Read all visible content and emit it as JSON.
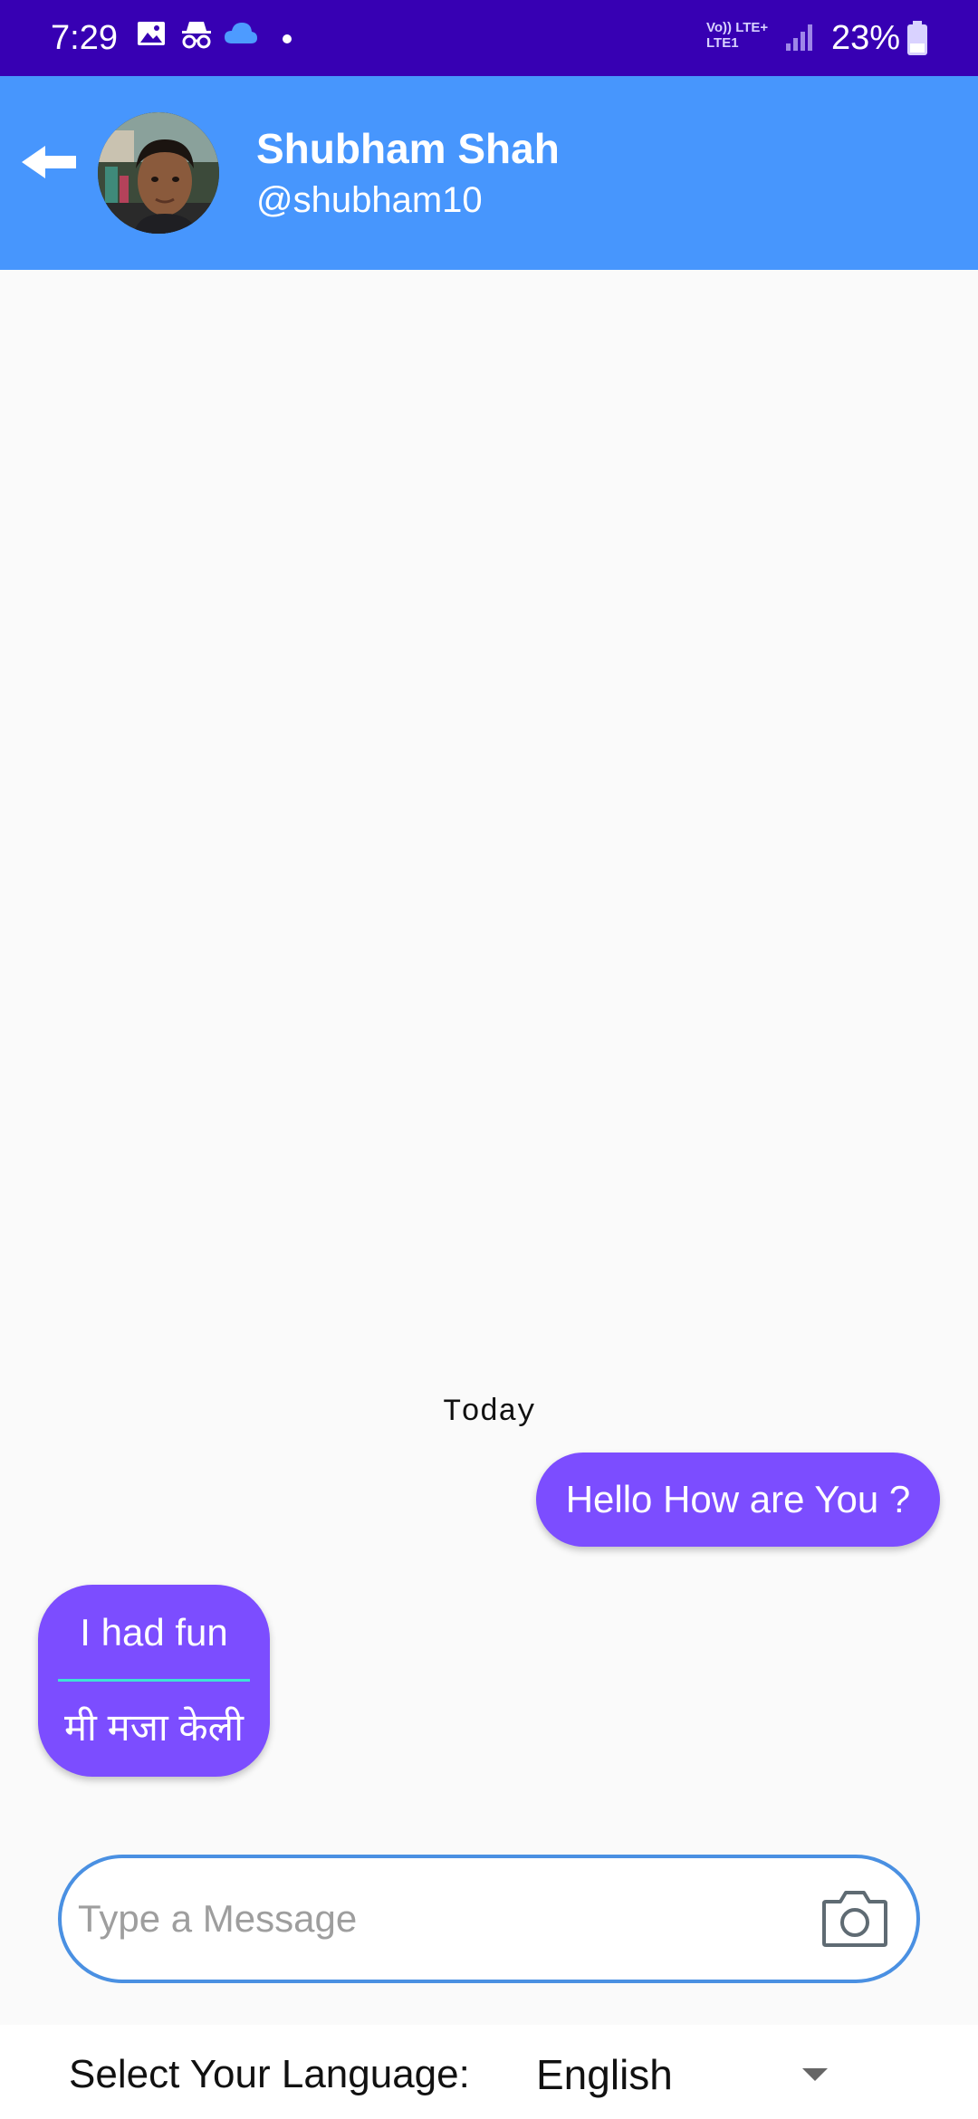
{
  "status_bar": {
    "time": "7:29",
    "network_line1": "Vo)) LTE+",
    "network_line2": "LTE1",
    "battery_percent": "23%",
    "icons": [
      "gallery-icon",
      "incognito-icon",
      "cloud-icon",
      "notification-dot-icon",
      "signal-icon",
      "battery-icon"
    ]
  },
  "header": {
    "contact_name": "Shubham Shah",
    "contact_handle": "@shubham10",
    "background_color": "#4796fd"
  },
  "chat": {
    "date_separator": "Today",
    "messages": [
      {
        "direction": "outgoing",
        "text": "Hello How are You ?"
      },
      {
        "direction": "incoming",
        "text": "I had fun",
        "translation": "मी मजा केली"
      }
    ],
    "bubble_color": "#7c4dff"
  },
  "composer": {
    "placeholder": "Type a Message",
    "value": ""
  },
  "language_bar": {
    "label": "Select Your Language:",
    "selected": "English"
  },
  "colors": {
    "status_bar": "#3700b3",
    "accent": "#4a90e2",
    "translation_divider": "#3de2d6"
  }
}
